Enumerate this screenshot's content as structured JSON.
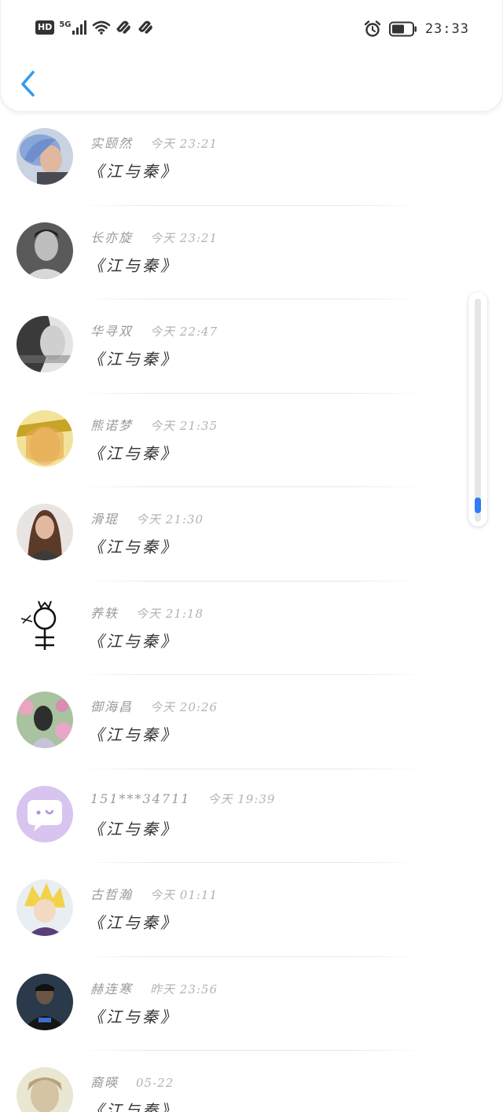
{
  "status_bar": {
    "hd_badge": "HD",
    "network": "5G",
    "time": "23:33",
    "icons": [
      "signal-icon",
      "wifi-icon",
      "link-icon",
      "link-icon",
      "alarm-icon",
      "battery-icon"
    ]
  },
  "header": {
    "back_icon": "chevron-left-icon",
    "accent": "#2f9bf0"
  },
  "scrollbar": {
    "progress": 0.96,
    "thumb_color": "#2f7cf6"
  },
  "messages": [
    {
      "name": "实颐然",
      "time": "今天 23:21",
      "content": "《江与秦》",
      "avatar": "blue-hair-man"
    },
    {
      "name": "长亦旋",
      "time": "今天 23:21",
      "content": "《江与秦》",
      "avatar": "bw-portrait-man"
    },
    {
      "name": "华寻双",
      "time": "今天 22:47",
      "content": "《江与秦》",
      "avatar": "bw-profile-woman"
    },
    {
      "name": "熊诺梦",
      "time": "今天 21:35",
      "content": "《江与秦》",
      "avatar": "yellow-art"
    },
    {
      "name": "滑琨",
      "time": "今天 21:30",
      "content": "《江与秦》",
      "avatar": "woman-portrait"
    },
    {
      "name": "养轶",
      "time": "今天 21:18",
      "content": "《江与秦》",
      "avatar": "doodle-sketch"
    },
    {
      "name": "御海昌",
      "time": "今天 20:26",
      "content": "《江与秦》",
      "avatar": "girl-flowers"
    },
    {
      "name": "151***34711",
      "time": "今天 19:39",
      "content": "《江与秦》",
      "avatar": "default-chat"
    },
    {
      "name": "古哲瀚",
      "time": "今天 01:11",
      "content": "《江与秦》",
      "avatar": "anime-boy"
    },
    {
      "name": "赫连寒",
      "time": "昨天 23:56",
      "content": "《江与秦》",
      "avatar": "dark-man"
    },
    {
      "name": "裔暎",
      "time": "05-22",
      "content": "《江与秦》",
      "avatar": "soft-portrait"
    }
  ]
}
